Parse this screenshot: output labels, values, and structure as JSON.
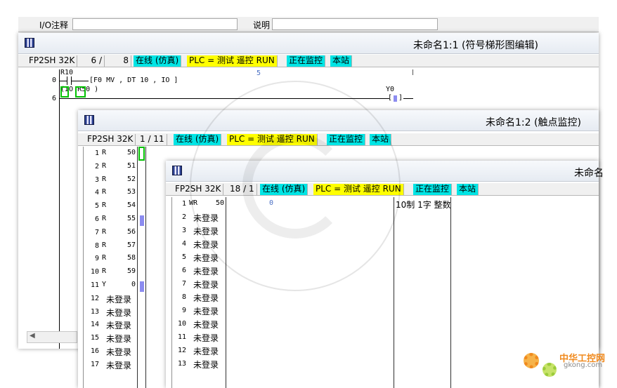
{
  "top_fields": {
    "io_label": "I/O注释",
    "desc_label": "说明"
  },
  "win1": {
    "title": "未命名1:1 (符号梯形图编辑)",
    "status": {
      "model": "FP2SH 32K",
      "step": "6 /",
      "total": "8",
      "online": "在线 (仿真)",
      "plc": "PLC =  测试 遥控 RUN",
      "monitoring": "正在监控",
      "station": "本站"
    },
    "ladder": {
      "r10": "R10",
      "row0": "0",
      "instr": "[F0 MV       ,   DT 10      ,   IO          ]",
      "dt_value": "5",
      "row6": "6",
      "contact": "(IO R50  )",
      "coil": "Y0"
    }
  },
  "win2": {
    "title": "未命名1:2 (触点监控)",
    "status": {
      "model": "FP2SH 32K",
      "step": "1 / 11",
      "online": "在线 (仿真)",
      "plc": "PLC =  测试 遥控 RUN",
      "monitoring": "正在监控",
      "station": "本站"
    },
    "rows": [
      {
        "n": "1",
        "dev": "R",
        "num": "50",
        "on": false
      },
      {
        "n": "2",
        "dev": "R",
        "num": "51",
        "on": false
      },
      {
        "n": "3",
        "dev": "R",
        "num": "52",
        "on": false
      },
      {
        "n": "4",
        "dev": "R",
        "num": "53",
        "on": false
      },
      {
        "n": "5",
        "dev": "R",
        "num": "54",
        "on": false
      },
      {
        "n": "6",
        "dev": "R",
        "num": "55",
        "on": true
      },
      {
        "n": "7",
        "dev": "R",
        "num": "56",
        "on": false
      },
      {
        "n": "8",
        "dev": "R",
        "num": "57",
        "on": false
      },
      {
        "n": "9",
        "dev": "R",
        "num": "58",
        "on": false
      },
      {
        "n": "10",
        "dev": "R",
        "num": "59",
        "on": false
      },
      {
        "n": "11",
        "dev": "Y",
        "num": "0",
        "on": true
      },
      {
        "n": "12",
        "dev": "未登录",
        "num": "",
        "on": false
      },
      {
        "n": "13",
        "dev": "未登录",
        "num": "",
        "on": false
      },
      {
        "n": "14",
        "dev": "未登录",
        "num": "",
        "on": false
      },
      {
        "n": "15",
        "dev": "未登录",
        "num": "",
        "on": false
      },
      {
        "n": "16",
        "dev": "未登录",
        "num": "",
        "on": false
      },
      {
        "n": "17",
        "dev": "未登录",
        "num": "",
        "on": false
      }
    ]
  },
  "win3": {
    "title": "未命名",
    "status": {
      "model": "FP2SH 32K",
      "step": "18 / 1",
      "online": "在线 (仿真)",
      "plc": "PLC =  测试 遥控 RUN",
      "monitoring": "正在监控",
      "station": "本站"
    },
    "rows": [
      {
        "n": "1",
        "dev": "WR",
        "num": "50",
        "value": "0",
        "fmt": "10制 1字 整数"
      },
      {
        "n": "2",
        "dev": "未登录"
      },
      {
        "n": "3",
        "dev": "未登录"
      },
      {
        "n": "4",
        "dev": "未登录"
      },
      {
        "n": "5",
        "dev": "未登录"
      },
      {
        "n": "6",
        "dev": "未登录"
      },
      {
        "n": "7",
        "dev": "未登录"
      },
      {
        "n": "8",
        "dev": "未登录"
      },
      {
        "n": "9",
        "dev": "未登录"
      },
      {
        "n": "10",
        "dev": "未登录"
      },
      {
        "n": "11",
        "dev": "未登录"
      },
      {
        "n": "12",
        "dev": "未登录"
      },
      {
        "n": "13",
        "dev": "未登录"
      }
    ]
  },
  "watermark": {
    "site_cn": "中华工控网",
    "site_url": "gkong.com"
  },
  "colors": {
    "cyan": "#00e5e5",
    "yellow": "#ffff00",
    "active_bit": "#8c8cf0",
    "cursor": "#00c000"
  }
}
